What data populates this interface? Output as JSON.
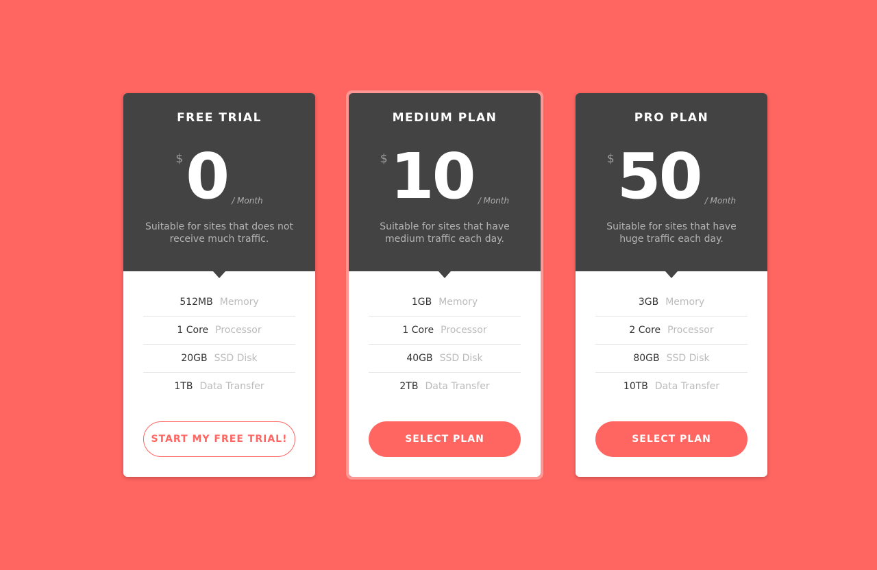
{
  "colors": {
    "background": "#ff6561",
    "header": "#434343",
    "accent": "#ff6561"
  },
  "plans": [
    {
      "title": "FREE TRIAL",
      "currency": "$",
      "amount": "0",
      "period": "/ Month",
      "description": "Suitable for sites that does not receive much traffic.",
      "features": [
        {
          "value": "512MB",
          "label": "Memory"
        },
        {
          "value": "1 Core",
          "label": "Processor"
        },
        {
          "value": "20GB",
          "label": "SSD Disk"
        },
        {
          "value": "1TB",
          "label": "Data Transfer"
        }
      ],
      "button": "START MY FREE TRIAL!"
    },
    {
      "title": "MEDIUM PLAN",
      "currency": "$",
      "amount": "10",
      "period": "/ Month",
      "description": "Suitable for sites that have medium traffic each day.",
      "features": [
        {
          "value": "1GB",
          "label": "Memory"
        },
        {
          "value": "1 Core",
          "label": "Processor"
        },
        {
          "value": "40GB",
          "label": "SSD Disk"
        },
        {
          "value": "2TB",
          "label": "Data Transfer"
        }
      ],
      "button": "SELECT PLAN"
    },
    {
      "title": "PRO PLAN",
      "currency": "$",
      "amount": "50",
      "period": "/ Month",
      "description": "Suitable for sites that have huge traffic each day.",
      "features": [
        {
          "value": "3GB",
          "label": "Memory"
        },
        {
          "value": "2 Core",
          "label": "Processor"
        },
        {
          "value": "80GB",
          "label": "SSD Disk"
        },
        {
          "value": "10TB",
          "label": "Data Transfer"
        }
      ],
      "button": "SELECT PLAN"
    }
  ]
}
